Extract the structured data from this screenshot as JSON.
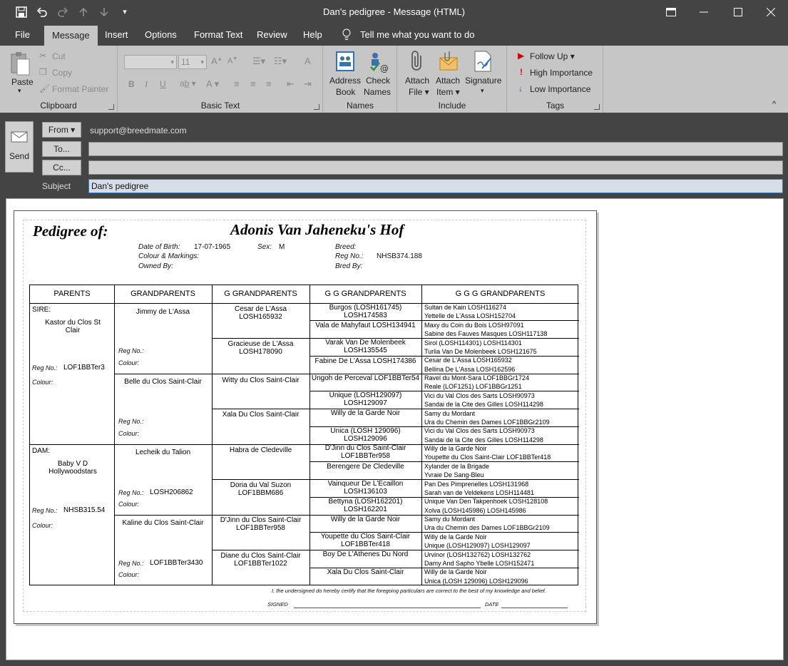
{
  "window": {
    "title": "Dan's pedigree  -  Message (HTML)",
    "quick_access": [
      "save-icon",
      "undo-icon",
      "redo-icon",
      "up-icon",
      "down-icon",
      "customize-icon"
    ]
  },
  "menu": {
    "tabs": [
      "File",
      "Message",
      "Insert",
      "Options",
      "Format Text",
      "Review",
      "Help"
    ],
    "tell_me": "Tell me what you want to do"
  },
  "ribbon": {
    "clipboard": {
      "paste": "Paste",
      "cut": "Cut",
      "copy": "Copy",
      "format_painter": "Format Painter",
      "label": "Clipboard"
    },
    "basic_text": {
      "font_size": "11",
      "label": "Basic Text",
      "bold": "B",
      "italic": "I",
      "underline": "U"
    },
    "names": {
      "address_book_1": "Address",
      "address_book_2": "Book",
      "check_names_1": "Check",
      "check_names_2": "Names",
      "label": "Names"
    },
    "include": {
      "attach_file_1": "Attach",
      "attach_file_2": "File",
      "attach_item_1": "Attach",
      "attach_item_2": "Item",
      "signature": "Signature",
      "label": "Include"
    },
    "tags": {
      "follow_up": "Follow Up",
      "high": "High Importance",
      "low": "Low Importance",
      "label": "Tags"
    }
  },
  "header": {
    "send": "Send",
    "from_btn": "From",
    "from_value": "support@breedmate.com",
    "to_btn": "To...",
    "cc_btn": "Cc...",
    "subject_label": "Subject",
    "subject_value": "Dan's pedigree"
  },
  "pedigree": {
    "heading": "Pedigree of:",
    "dog_name": "Adonis Van Jaheneku's Hof",
    "dob_label": "Date of Birth:",
    "dob": "17-07-1965",
    "sex_label": "Sex:",
    "sex": "M",
    "colour_label": "Colour & Markings:",
    "owned_label": "Owned By:",
    "breed_label": "Breed:",
    "reg_label": "Reg No.:",
    "reg": "NHSB374.188",
    "bred_label": "Bred By:",
    "headers": [
      "PARENTS",
      "GRANDPARENTS",
      "G GRANDPARENTS",
      "G G GRANDPARENTS",
      "G G G GRANDPARENTS"
    ],
    "sire_label": "SIRE:",
    "sire": "Kastor du Clos St Clair",
    "sire_reg": "LOF1BBTer3",
    "dam_label": "DAM:",
    "dam": "Baby V D Hollywoodstars",
    "dam_reg": "NHSB315.54",
    "reg_no_label": "Reg No.:",
    "colour_field_label": "Colour:",
    "grandparents": [
      {
        "name": "Jimmy de L'Assa",
        "reg": ""
      },
      {
        "name": "Belle du Clos Saint-Clair",
        "reg": ""
      },
      {
        "name": "Lecheik du Talion",
        "reg": "LOSH206862"
      },
      {
        "name": "Kaline du Clos Saint-Clair",
        "reg": "LOF1BBTer3430"
      }
    ],
    "g_grandparents": [
      "Cesar de L'Assa LOSH165932",
      "Gracieuse de L'Assa LOSH178090",
      "Witty du Clos Saint-Clair",
      "Xala Du Clos Saint-Clair",
      "Habra de Cledeville",
      "Doria du Val Suzon LOF1BBM686",
      "D'Jinn du Clos Saint-Clair LOF1BBTer958",
      "Diane du Clos Saint-Clair LOF1BBTer1022"
    ],
    "gg_grandparents": [
      "Burgos (LOSH161745) LOSH174583",
      "Vala de Mahyfaut LOSH134941",
      "Varak Van De Molenbeek LOSH135545",
      "Fabine De L'Assa LOSH174386",
      "Ungoh de Perceval LOF1BBTer54",
      "Unique (LOSH129097) LOSH129097",
      "Willy de la Garde Noir",
      "Unica (LOSH 129096) LOSH129096",
      "D'Jinn du Clos Saint-Clair LOF1BBTer958",
      "Berengere De Cledeville",
      "Vainqueur De L'Ecaillon LOSH136103",
      "Bettyna (LOSH162201) LOSH162201",
      "Willy de la Garde Noir",
      "Youpette du Clos Saint-Clair LOF1BBTer418",
      "Boy De L'Athenes Du Nord",
      "Xala Du Clos Saint-Clair"
    ],
    "ggg_grandparents": [
      "Sultan de Kain LOSH116274",
      "Yettelle de L'Assa LOSH152704",
      "Maxy du Coin du Bois LOSH97091",
      "Sabine des Fauves Masques LOSH117138",
      "Sirol (LOSH114301) LOSH114301",
      "Turlia Van De Molenbeek LOSH121675",
      "Cesar de L'Assa LOSH165932",
      "Bellina De L'Assa LOSH162596",
      "Ravel du Mont-Sara LOF1BBGr1724",
      "Reale (LOF1251) LOF1BBGr1251",
      "Vici du Val Clos des Sarts LOSH90973",
      "Sandai de la Cite des Gilles LOSH114298",
      "Samy du Mordant",
      "Ura du Chemin des Dames LOF1BBGr2109",
      "Vici du Val Clos des Sarts LOSH90973",
      "Sandai de la Cite des Gilles LOSH114298",
      "Willy de la Garde Noir",
      "Youpette du Clos Saint-Clair LOF1BBTer418",
      "Xylander de la Brigade",
      "Yvraie De Sang-Bleu",
      "Pan Des Pimprenelles LOSH131968",
      "Sarah van de Veldekens LOSH114481",
      "Unique Van Den Takpenhoek LOSH128108",
      "Xolva (LOSH145986) LOSH145986",
      "Samy du Mordant",
      "Ura du Chemin des Dames LOF1BBGr2109",
      "Willy de la Garde Noir",
      "Unique  (LOSH129097) LOSH129097",
      "Urvinor (LOSH132762) LOSH132762",
      "Damy And Sapho Ybelle LOSH152471",
      "Willy de la Garde Noir",
      "Unica (LOSH 129096) LOSH129096"
    ],
    "certify": "I, the undersigned do hereby certify that the foregoing particulars are correct to the best of my knowledge and belief.",
    "signed_label": "SIGNED",
    "date_label": "DATE"
  }
}
